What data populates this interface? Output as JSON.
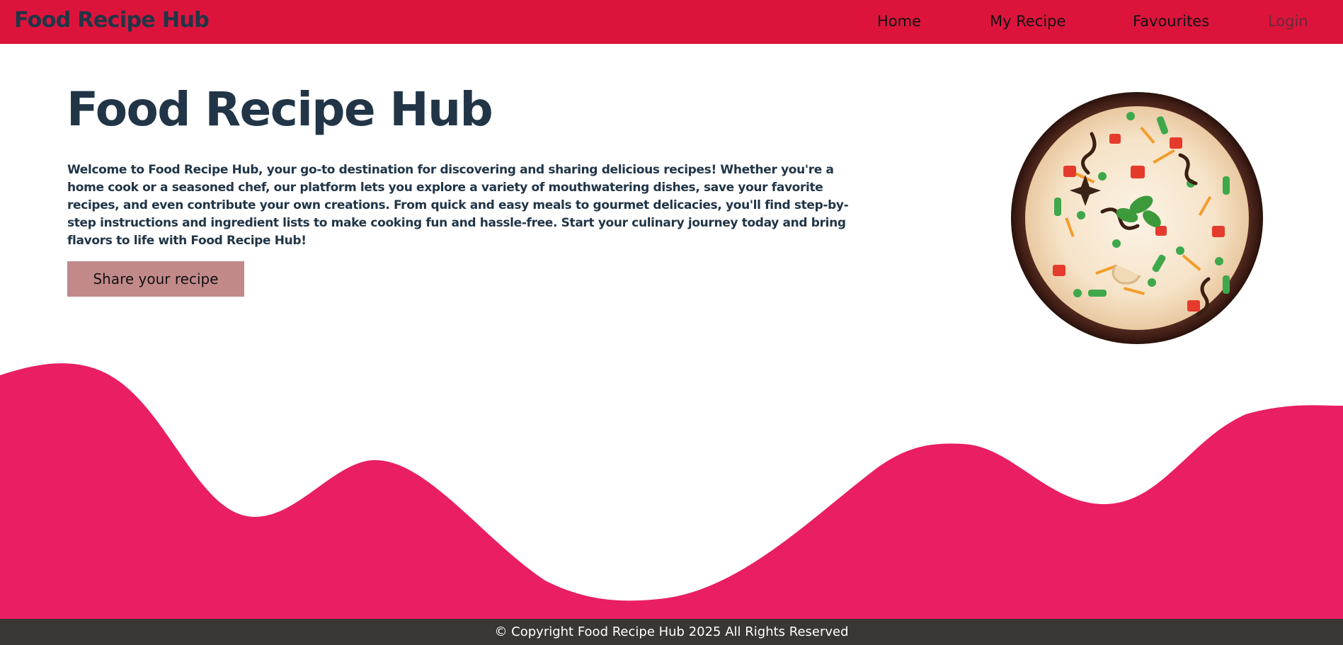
{
  "navbar": {
    "brand": "Food Recipe Hub",
    "links": [
      "Home",
      "My Recipe",
      "Favourites"
    ],
    "login": "Login",
    "color": "#dc143c"
  },
  "hero": {
    "title": "Food Recipe Hub",
    "description": "Welcome to Food Recipe Hub, your go-to destination for discovering and sharing delicious recipes! Whether you're a home cook or a seasoned chef, our platform lets you explore a variety of mouthwatering dishes, save your favorite recipes, and even contribute your own creations. From quick and easy meals to gourmet delicacies, you'll find step-by-step instructions and ingredient lists to make cooking fun and hassle-free. Start your culinary journey today and bring flavors to life with Food Recipe Hub!",
    "share_button": "Share your recipe",
    "image_icon": "biryani-bowl-image"
  },
  "colors": {
    "wave": "#e91e63",
    "title": "#213547",
    "button": "#c2898a",
    "footer": "#3a3634"
  },
  "footer": {
    "copyright": "© Copyright Food Recipe Hub 2025 All Rights Reserved"
  }
}
